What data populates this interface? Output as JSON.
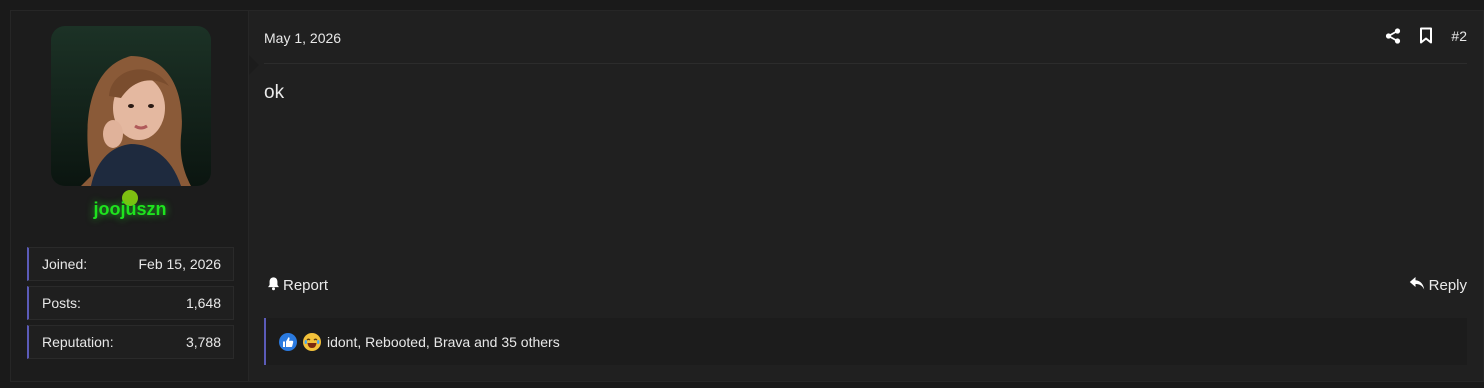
{
  "user": {
    "username": "joojuszn",
    "avatar_icon": "avatar-photo",
    "online": true,
    "stats": [
      {
        "label": "Joined:",
        "value": "Feb 15, 2026"
      },
      {
        "label": "Posts:",
        "value": "1,648"
      },
      {
        "label": "Reputation:",
        "value": "3,788"
      }
    ]
  },
  "post": {
    "date": "May 1, 2026",
    "number": "#2",
    "message": "ok",
    "share_icon": "share-icon",
    "bookmark_icon": "bookmark-icon"
  },
  "footer": {
    "report_label": "Report",
    "reply_label": "Reply"
  },
  "reactions": {
    "icons": [
      "like-icon",
      "laugh-icon"
    ],
    "text": "idont, Rebooted, Brava and 35 others"
  },
  "colors": {
    "username": "#1ee31e",
    "accent": "#5b5bb8",
    "online": "#7fbf12"
  }
}
